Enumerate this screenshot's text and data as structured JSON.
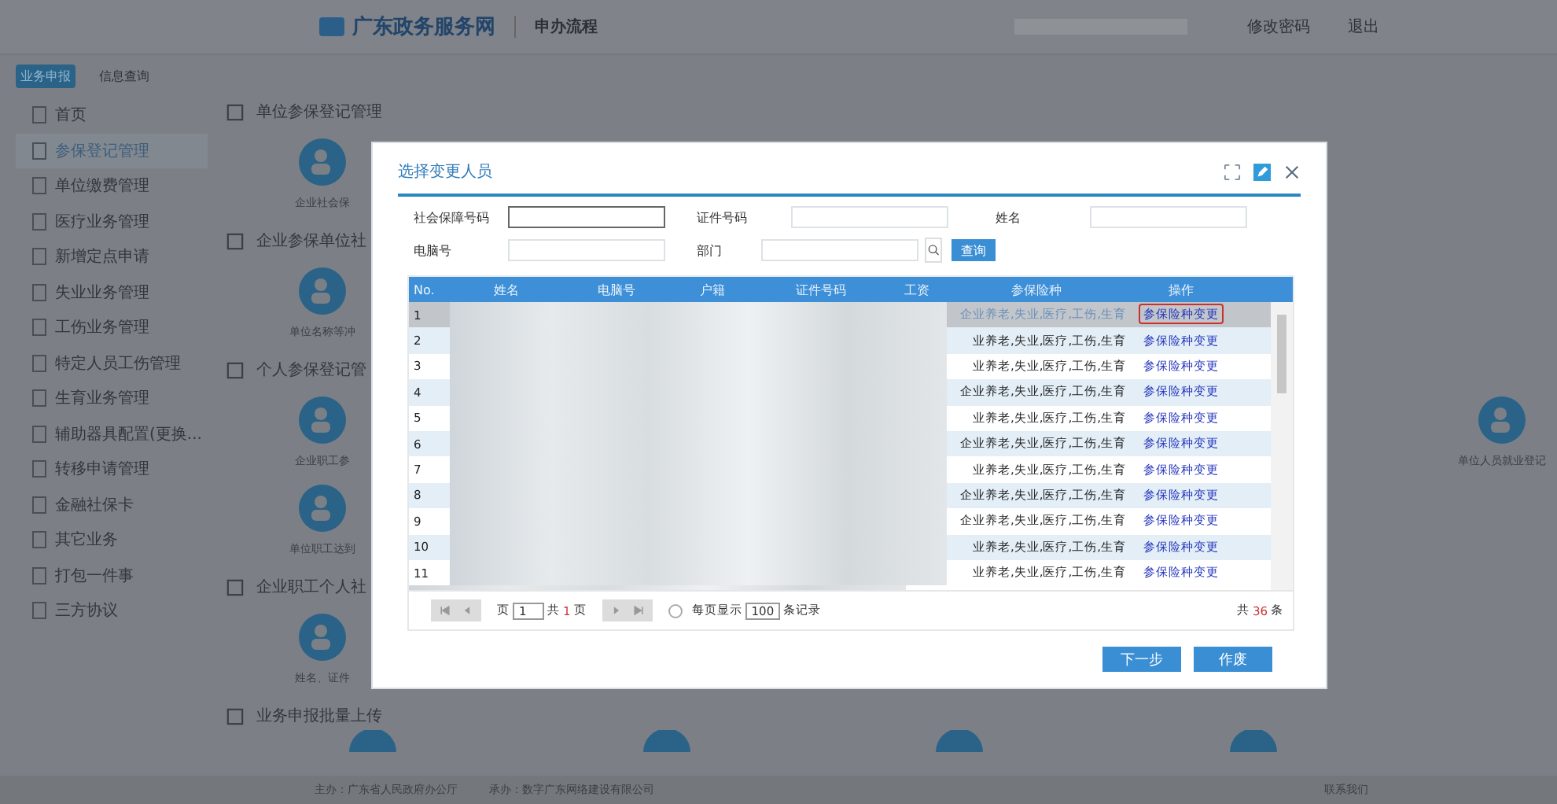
{
  "header": {
    "logo_text": "广东政务服务网",
    "flow_link": "申办流程",
    "links": [
      "修改密码",
      "退出"
    ]
  },
  "sidebar": {
    "tabs": [
      {
        "label": "业务申报",
        "selected": true
      },
      {
        "label": "信息查询",
        "selected": false
      }
    ],
    "items": [
      {
        "label": "首页",
        "selected": false
      },
      {
        "label": "参保登记管理",
        "selected": true
      },
      {
        "label": "单位缴费管理",
        "selected": false
      },
      {
        "label": "医疗业务管理",
        "selected": false
      },
      {
        "label": "新增定点申请",
        "selected": false
      },
      {
        "label": "失业业务管理",
        "selected": false
      },
      {
        "label": "工伤业务管理",
        "selected": false
      },
      {
        "label": "特定人员工伤管理",
        "selected": false
      },
      {
        "label": "生育业务管理",
        "selected": false
      },
      {
        "label": "辅助器具配置(更换...",
        "selected": false
      },
      {
        "label": "转移申请管理",
        "selected": false
      },
      {
        "label": "金融社保卡",
        "selected": false
      },
      {
        "label": "其它业务",
        "selected": false
      },
      {
        "label": "打包一件事",
        "selected": false
      },
      {
        "label": "三方协议",
        "selected": false
      }
    ]
  },
  "sections": [
    {
      "title": "单位参保登记管理",
      "tiles": [
        "企业社会保"
      ]
    },
    {
      "title": "企业参保单位社",
      "tiles": [
        "单位名称等冲"
      ]
    },
    {
      "title": "个人参保登记管",
      "tiles": [
        "企业职工参",
        "单位人员就业登记"
      ]
    },
    {
      "tiles": [
        "单位职工达到"
      ]
    },
    {
      "title": "企业职工个人社",
      "tiles": [
        "姓名、证件"
      ]
    },
    {
      "title": "业务申报批量上传"
    }
  ],
  "footer": {
    "sponsor": "主办：广东省人民政府办公厅",
    "operator": "承办：数字广东网络建设有限公司",
    "contact": "联系我们"
  },
  "dialog": {
    "title": "选择变更人员",
    "fields": [
      {
        "label": "社会保障号码"
      },
      {
        "label": "证件号码"
      },
      {
        "label": "姓名"
      },
      {
        "label": "电脑号"
      },
      {
        "label": "部门"
      }
    ],
    "query_button": "查询",
    "columns": [
      "No.",
      "姓名",
      "电脑号",
      "户籍",
      "证件号码",
      "工资",
      "参保险种",
      "操作"
    ],
    "rows": [
      {
        "no": "1",
        "insurance": "企业养老,失业,医疗,工伤,生育",
        "action": "参保险种变更",
        "selected": true
      },
      {
        "no": "2",
        "insurance": "业养老,失业,医疗,工伤,生育",
        "action": "参保险种变更",
        "selected": false
      },
      {
        "no": "3",
        "insurance": "业养老,失业,医疗,工伤,生育",
        "action": "参保险种变更",
        "selected": false
      },
      {
        "no": "4",
        "insurance": "企业养老,失业,医疗,工伤,生育",
        "action": "参保险种变更",
        "selected": false
      },
      {
        "no": "5",
        "insurance": "业养老,失业,医疗,工伤,生育",
        "action": "参保险种变更",
        "selected": false
      },
      {
        "no": "6",
        "insurance": "企业养老,失业,医疗,工伤,生育",
        "action": "参保险种变更",
        "selected": false
      },
      {
        "no": "7",
        "insurance": "业养老,失业,医疗,工伤,生育",
        "action": "参保险种变更",
        "selected": false
      },
      {
        "no": "8",
        "insurance": "企业养老,失业,医疗,工伤,生育",
        "action": "参保险种变更",
        "selected": false
      },
      {
        "no": "9",
        "insurance": "企业养老,失业,医疗,工伤,生育",
        "action": "参保险种变更",
        "selected": false
      },
      {
        "no": "10",
        "insurance": "业养老,失业,医疗,工伤,生育",
        "action": "参保险种变更",
        "selected": false
      },
      {
        "no": "11",
        "insurance": "业养老,失业,医疗,工伤,生育",
        "action": "参保险种变更",
        "selected": false
      }
    ],
    "pager": {
      "page_label": "页",
      "page": "1",
      "total_label": "共",
      "total_pages": "1",
      "pages_label": "页",
      "per_page_label": "每页显示",
      "per_page": "100",
      "records_label": "条记录",
      "count_label": "共",
      "count": "36",
      "count_unit": "条"
    },
    "buttons": [
      "下一步",
      "作废"
    ]
  }
}
